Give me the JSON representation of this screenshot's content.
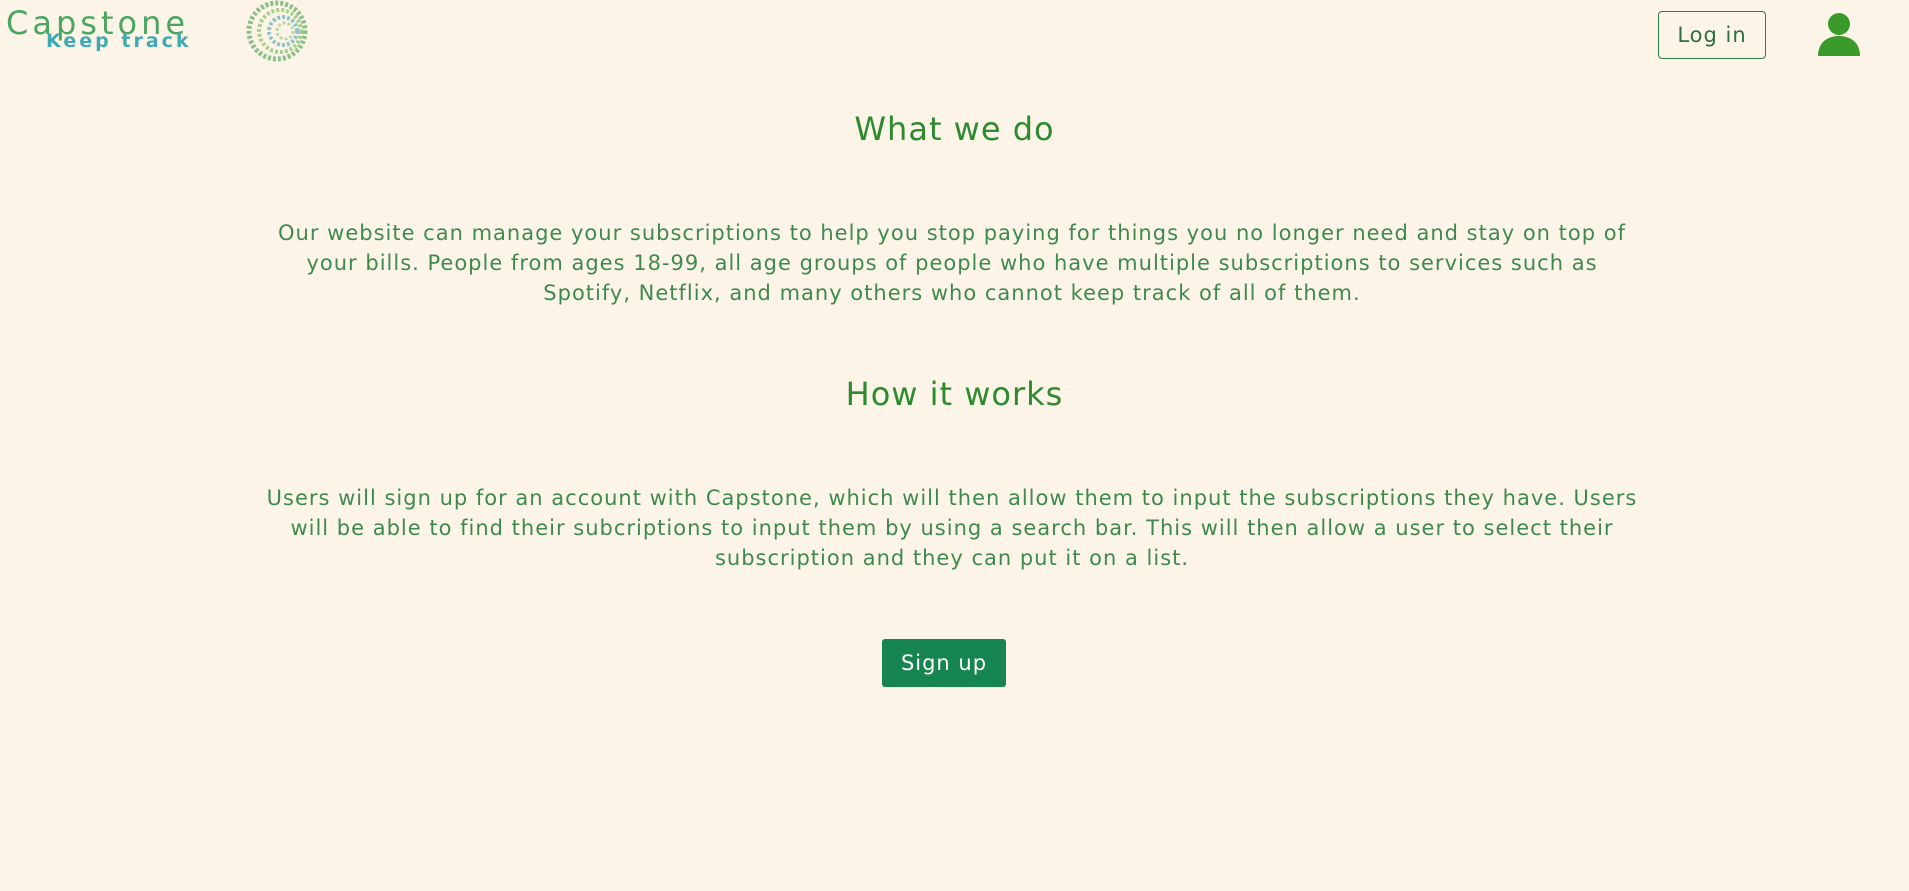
{
  "header": {
    "logo": {
      "title": "Capstone",
      "subtitle": "Keep track",
      "mark_icon": "binary-spiral-logo-icon"
    },
    "login_label": "Log in",
    "user_icon": "user-icon"
  },
  "sections": {
    "what": {
      "title": "What we do",
      "text": "Our website can manage your subscriptions to help you stop paying for things you no longer need and stay on top of your bills. People from ages 18-99, all age groups of people who have multiple subscriptions to services such as Spotify, Netflix, and many others who cannot keep track of all of them."
    },
    "how": {
      "title": "How it works",
      "text": "Users will sign up for an account with Capstone, which will then allow them to input the subscriptions they have. Users will be able to find their subcriptions to input them by using a search bar. This will then allow a user to select their subscription and they can put it on a list."
    }
  },
  "signup_label": "Sign up",
  "colors": {
    "background": "#fdf4e8",
    "heading": "#2c8a2f",
    "body_text": "#3e8a4e",
    "signup_bg": "#17854f",
    "user_icon": "#3a9a2a"
  }
}
